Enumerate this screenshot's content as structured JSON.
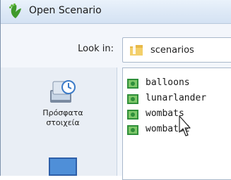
{
  "window": {
    "title": "Open Scenario",
    "app_icon": "greenfoot-icon"
  },
  "look_in": {
    "label": "Look in:",
    "value": "scenarios",
    "icon": "folder-icon"
  },
  "places": [
    {
      "label": "Πρόσφατα στοιχεία",
      "icon": "recent-items-icon"
    },
    {
      "label": "",
      "icon": "desktop-icon"
    }
  ],
  "files": [
    {
      "name": "balloons",
      "icon": "scenario-icon"
    },
    {
      "name": "lunarlander",
      "icon": "scenario-icon"
    },
    {
      "name": "wombats",
      "icon": "scenario-icon"
    },
    {
      "name": "wombats2",
      "icon": "scenario-icon"
    }
  ]
}
